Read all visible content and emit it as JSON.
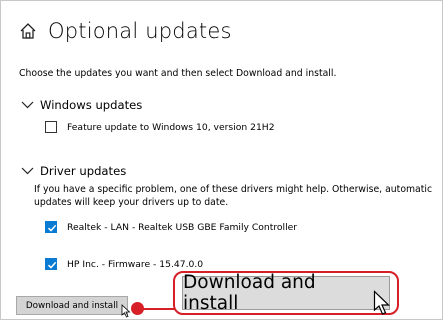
{
  "header": {
    "title": "Optional updates",
    "icon": "home-icon"
  },
  "intro_text": "Choose the updates you want and then select Download and install.",
  "windows_updates": {
    "title": "Windows updates",
    "items": [
      {
        "label": "Feature update to Windows 10, version 21H2",
        "checked": false
      }
    ]
  },
  "driver_updates": {
    "title": "Driver updates",
    "description": "If you have a specific problem, one of these drivers might help. Otherwise, automatic updates will keep your drivers up to date.",
    "items": [
      {
        "label": "Realtek - LAN - Realtek USB GBE Family Controller",
        "checked": true
      },
      {
        "label": "HP Inc. - Firmware - 15.47.0.0",
        "checked": true
      }
    ]
  },
  "actions": {
    "download_install_label": "Download and install",
    "zoom_label": "Download and install"
  },
  "colors": {
    "accent": "#0a7bd3",
    "highlight": "#d61f26"
  }
}
